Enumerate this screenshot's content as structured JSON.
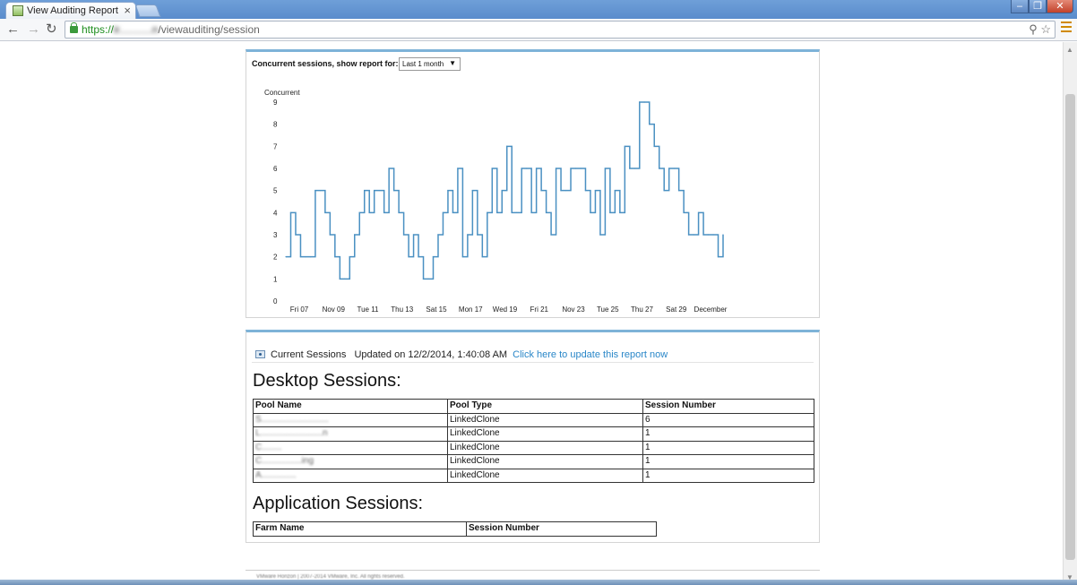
{
  "browser": {
    "tab_title": "View Auditing Report",
    "tab_close": "×",
    "url_https": "https://",
    "url_host": "ir...........n",
    "url_path": "/viewauditing/session",
    "window_min": "–",
    "window_max": "❐",
    "window_close": "✕"
  },
  "chart_panel": {
    "heading": "Concurrent sessions, show report for:",
    "range_selected": "Last 1 month"
  },
  "chart_data": {
    "type": "line",
    "step": true,
    "ylabel": "Concurrent",
    "ylim": [
      0,
      9
    ],
    "yticks": [
      0,
      1,
      2,
      3,
      4,
      5,
      6,
      7,
      8,
      9
    ],
    "x_tick_labels": [
      "Fri 07",
      "Nov 09",
      "Tue 11",
      "Thu 13",
      "Sat 15",
      "Mon 17",
      "Wed 19",
      "Fri 21",
      "Nov 23",
      "Tue 25",
      "Thu 27",
      "Sat 29",
      "December"
    ],
    "color": "#4a90c2",
    "values": [
      2,
      4,
      3,
      2,
      2,
      2,
      5,
      5,
      4,
      3,
      2,
      1,
      1,
      2,
      3,
      4,
      5,
      4,
      5,
      5,
      4,
      6,
      5,
      4,
      3,
      2,
      3,
      2,
      1,
      1,
      2,
      3,
      4,
      5,
      4,
      6,
      2,
      3,
      5,
      3,
      2,
      4,
      6,
      4,
      5,
      7,
      4,
      4,
      6,
      6,
      4,
      6,
      5,
      4,
      3,
      6,
      5,
      5,
      6,
      6,
      6,
      5,
      4,
      5,
      3,
      6,
      4,
      5,
      4,
      7,
      6,
      6,
      9,
      9,
      8,
      7,
      6,
      5,
      6,
      6,
      5,
      4,
      3,
      3,
      4,
      3,
      3,
      3,
      2,
      3
    ]
  },
  "sessions_panel": {
    "status_label": "Current Sessions",
    "updated_text": "Updated on 12/2/2014, 1:40:08 AM",
    "update_link": "Click here to update this report now",
    "desktop_heading": "Desktop Sessions:",
    "desktop_columns": [
      "Pool Name",
      "Pool Type",
      "Session Number"
    ],
    "desktop_rows": [
      [
        "S...........................",
        "LinkedClone",
        "6"
      ],
      [
        "L.........................n",
        "LinkedClone",
        "1"
      ],
      [
        "C........",
        "LinkedClone",
        "1"
      ],
      [
        "C................ing",
        "LinkedClone",
        "1"
      ],
      [
        "A..............",
        "LinkedClone",
        "1"
      ]
    ],
    "app_heading": "Application Sessions:",
    "app_columns": [
      "Farm Name",
      "Session Number"
    ]
  },
  "footer": {
    "text": "VMware Horizon  |  2007-2014 VMware, Inc. All rights reserved."
  }
}
